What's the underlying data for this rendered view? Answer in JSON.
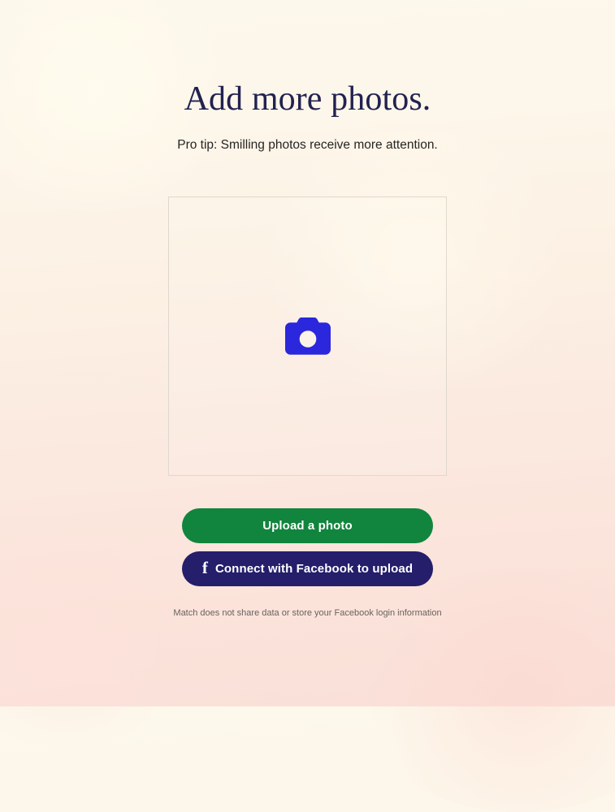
{
  "background": {
    "top_color": "#fdf8ec",
    "bottom_color": "#fae0d8"
  },
  "header": {
    "title": "Add more photos.",
    "subtitle": "Pro tip: Smilling photos receive more attention."
  },
  "upload_area": {
    "icon": "camera-icon",
    "icon_color": "#2b27dd",
    "border_color": "#e0d8cd"
  },
  "actions": {
    "upload_label": "Upload a photo",
    "upload_color": "#11853d",
    "facebook_label": "Connect with Facebook to upload",
    "facebook_color": "#241e6b",
    "facebook_glyph": "f"
  },
  "footer": {
    "disclaimer": "Match does not share data or store your Facebook login information"
  }
}
